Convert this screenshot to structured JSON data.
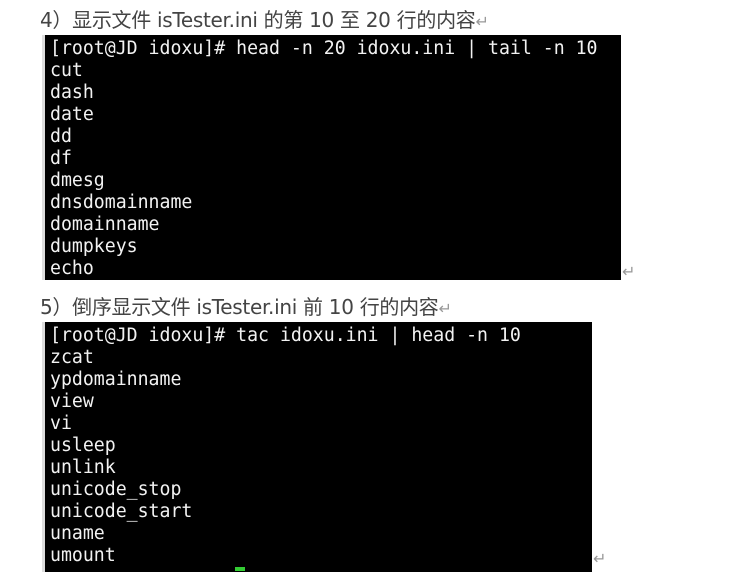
{
  "section4": {
    "heading": "4）显示文件 isTester.ini  的第 10 至 20 行的内容",
    "command": "[root@JD idoxu]# head -n 20 idoxu.ini | tail -n 10",
    "output": [
      "cut",
      "dash",
      "date",
      "dd",
      "df",
      "dmesg",
      "dnsdomainname",
      "domainname",
      "dumpkeys",
      "echo"
    ]
  },
  "section5": {
    "heading": "5）倒序显示文件 isTester.ini  前 10 行的内容",
    "command": "[root@JD idoxu]# tac idoxu.ini | head -n 10",
    "output": [
      "zcat",
      "ypdomainname",
      "view",
      "vi",
      "usleep",
      "unlink",
      "unicode_stop",
      "unicode_start",
      "uname",
      "umount"
    ]
  },
  "return_mark": "↵"
}
